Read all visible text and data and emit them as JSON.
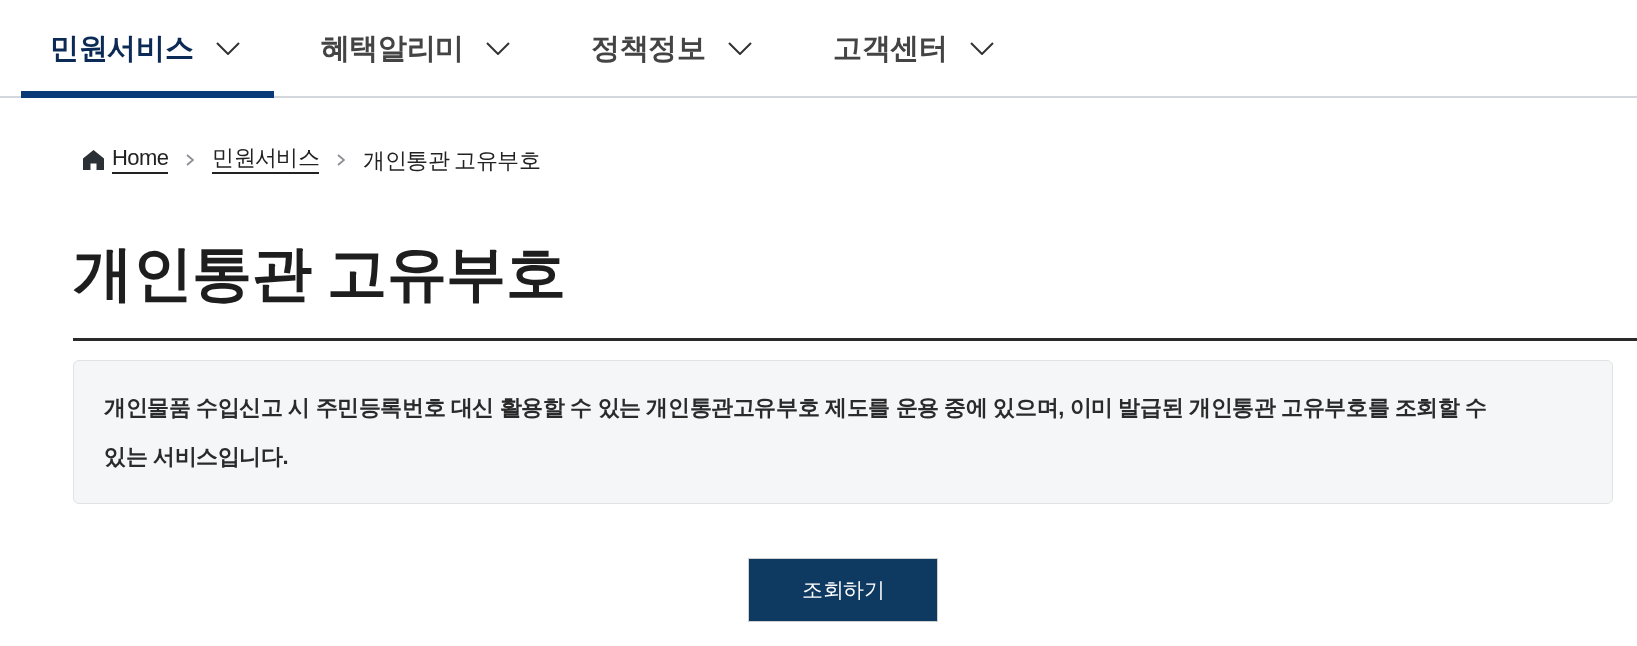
{
  "nav": {
    "tabs": [
      {
        "label": "민원서비스",
        "selected": true
      },
      {
        "label": "혜택알리미",
        "selected": false
      },
      {
        "label": "정책정보",
        "selected": false
      },
      {
        "label": "고객센터",
        "selected": false
      }
    ]
  },
  "breadcrumb": [
    {
      "label": "Home",
      "kind": "home"
    },
    {
      "label": "민원서비스",
      "kind": "link"
    },
    {
      "label": "개인통관 고유부호",
      "kind": "current"
    }
  ],
  "page": {
    "title": "개인통관 고유부호",
    "description": "개인물품 수입신고 시 주민등록번호 대신 활용할 수 있는 개인통관고유부호 제도를 운용 중에 있으며, 이미 발급된 개인통관 고유부호를 조회할 수 있는 서비스입니다.",
    "button": "조회하기"
  }
}
